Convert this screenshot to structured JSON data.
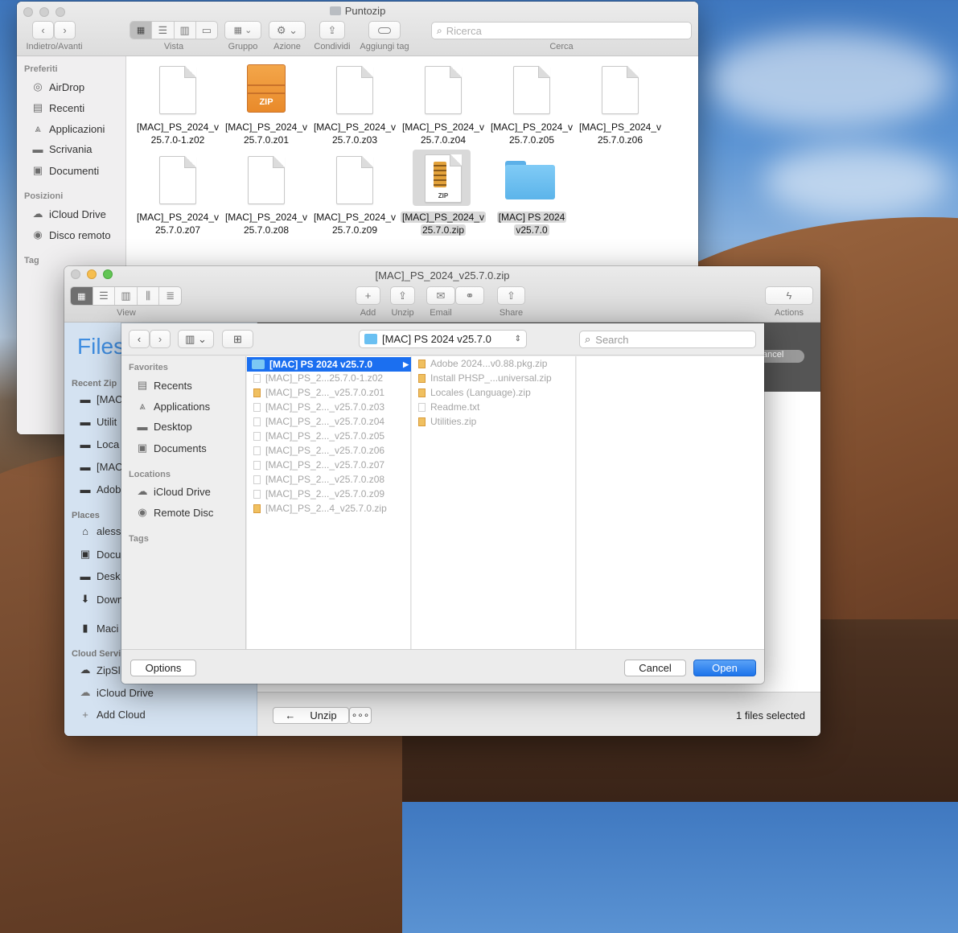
{
  "finder": {
    "title": "Puntozip",
    "toolbar": {
      "nav_label": "Indietro/Avanti",
      "view_label": "Vista",
      "group_label": "Gruppo",
      "action_label": "Azione",
      "share_label": "Condividi",
      "tag_label": "Aggiungi tag",
      "search_label": "Cerca",
      "search_placeholder": "Ricerca"
    },
    "sidebar": {
      "favorites_header": "Preferiti",
      "favorites": [
        {
          "label": "AirDrop",
          "icon": "airdrop-icon"
        },
        {
          "label": "Recenti",
          "icon": "clock-icon"
        },
        {
          "label": "Applicazioni",
          "icon": "applications-icon"
        },
        {
          "label": "Scrivania",
          "icon": "desktop-icon"
        },
        {
          "label": "Documenti",
          "icon": "document-icon"
        }
      ],
      "locations_header": "Posizioni",
      "locations": [
        {
          "label": "iCloud Drive",
          "icon": "cloud-icon"
        },
        {
          "label": "Disco remoto",
          "icon": "disc-icon"
        }
      ],
      "tags_header": "Tag"
    },
    "files": [
      {
        "line1": "[MAC]_PS_2024_v",
        "line2": "25.7.0-1.z02",
        "kind": "doc"
      },
      {
        "line1": "[MAC]_PS_2024_v",
        "line2": "25.7.0.z01",
        "kind": "zip-orange"
      },
      {
        "line1": "[MAC]_PS_2024_v",
        "line2": "25.7.0.z03",
        "kind": "doc"
      },
      {
        "line1": "[MAC]_PS_2024_v",
        "line2": "25.7.0.z04",
        "kind": "doc"
      },
      {
        "line1": "[MAC]_PS_2024_v",
        "line2": "25.7.0.z05",
        "kind": "doc"
      },
      {
        "line1": "[MAC]_PS_2024_v",
        "line2": "25.7.0.z06",
        "kind": "doc"
      },
      {
        "line1": "[MAC]_PS_2024_v",
        "line2": "25.7.0.z07",
        "kind": "doc"
      },
      {
        "line1": "[MAC]_PS_2024_v",
        "line2": "25.7.0.z08",
        "kind": "doc"
      },
      {
        "line1": "[MAC]_PS_2024_v",
        "line2": "25.7.0.z09",
        "kind": "doc"
      },
      {
        "line1": "[MAC]_PS_2024_v",
        "line2": "25.7.0.zip",
        "kind": "zip-archive",
        "selected": true
      },
      {
        "line1": "[MAC] PS 2024",
        "line2": "v25.7.0",
        "kind": "folder",
        "selected": true
      }
    ]
  },
  "app": {
    "title": "[MAC]_PS_2024_v25.7.0.zip",
    "toolbar": {
      "view_label": "View",
      "add_label": "Add",
      "unzip_label": "Unzip",
      "email_label": "Email",
      "share_label": "Share",
      "actions_label": "Actions"
    },
    "logo": "Files",
    "recent_header": "Recent Zip",
    "recent": [
      "[MAC",
      "Utilit",
      "Loca",
      "[MAC",
      "Adob"
    ],
    "places_header": "Places",
    "places": [
      {
        "label": "aless",
        "icon": "home-icon"
      },
      {
        "label": "Docu",
        "icon": "document-icon"
      },
      {
        "label": "Desk",
        "icon": "desktop-icon"
      },
      {
        "label": "Down",
        "icon": "download-icon"
      },
      {
        "label": "Maci",
        "icon": "drive-icon"
      }
    ],
    "cloud_header": "Cloud Servi",
    "cloud": [
      {
        "label": "ZipSl",
        "icon": "cloud-filled-icon"
      },
      {
        "label": "iCloud Drive",
        "icon": "cloud-icon"
      },
      {
        "label": "Add Cloud",
        "icon": "plus-icon"
      }
    ],
    "cancel_partial": "ancel",
    "bottom": {
      "unzip_button": "Unzip",
      "more_button": "∘∘∘",
      "status": "1 files selected"
    }
  },
  "dialog": {
    "path_popup": "[MAC] PS 2024 v25.7.0",
    "search_placeholder": "Search",
    "sidebar": {
      "favorites_header": "Favorites",
      "favorites": [
        {
          "label": "Recents",
          "icon": "clock-icon"
        },
        {
          "label": "Applications",
          "icon": "applications-icon"
        },
        {
          "label": "Desktop",
          "icon": "desktop-icon"
        },
        {
          "label": "Documents",
          "icon": "document-icon"
        }
      ],
      "locations_header": "Locations",
      "locations": [
        {
          "label": "iCloud Drive",
          "icon": "cloud-icon"
        },
        {
          "label": "Remote Disc",
          "icon": "disc-icon"
        }
      ],
      "tags_header": "Tags"
    },
    "column1": [
      {
        "label": "[MAC] PS 2024 v25.7.0",
        "selected": true,
        "kind": "folder"
      },
      {
        "label": "[MAC]_PS_2...25.7.0-1.z02",
        "kind": "doc"
      },
      {
        "label": "[MAC]_PS_2..._v25.7.0.z01",
        "kind": "zip"
      },
      {
        "label": "[MAC]_PS_2..._v25.7.0.z03",
        "kind": "doc"
      },
      {
        "label": "[MAC]_PS_2..._v25.7.0.z04",
        "kind": "doc"
      },
      {
        "label": "[MAC]_PS_2..._v25.7.0.z05",
        "kind": "doc"
      },
      {
        "label": "[MAC]_PS_2..._v25.7.0.z06",
        "kind": "doc"
      },
      {
        "label": "[MAC]_PS_2..._v25.7.0.z07",
        "kind": "doc"
      },
      {
        "label": "[MAC]_PS_2..._v25.7.0.z08",
        "kind": "doc"
      },
      {
        "label": "[MAC]_PS_2..._v25.7.0.z09",
        "kind": "doc"
      },
      {
        "label": "[MAC]_PS_2...4_v25.7.0.zip",
        "kind": "zip"
      }
    ],
    "column2": [
      {
        "label": "Adobe 2024...v0.88.pkg.zip",
        "kind": "zip"
      },
      {
        "label": "Install PHSP_...universal.zip",
        "kind": "zip"
      },
      {
        "label": "Locales (Language).zip",
        "kind": "zip"
      },
      {
        "label": "Readme.txt",
        "kind": "doc"
      },
      {
        "label": "Utilities.zip",
        "kind": "zip"
      }
    ],
    "options_button": "Options",
    "cancel_button": "Cancel",
    "open_button": "Open"
  }
}
